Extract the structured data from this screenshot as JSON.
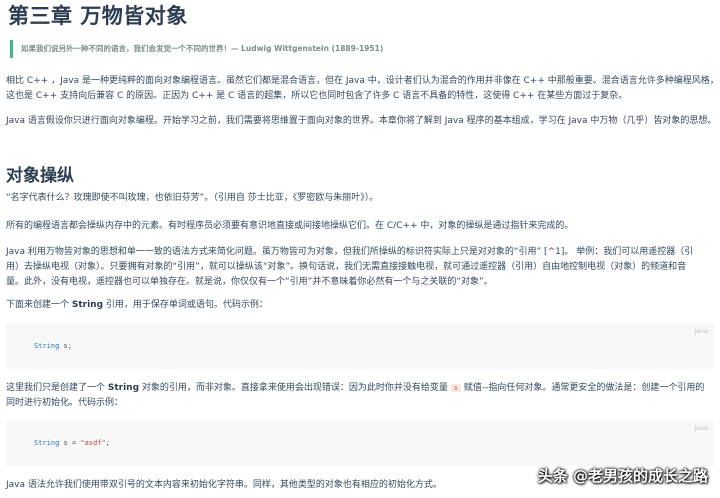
{
  "chapter_title": "第三章 万物皆对象",
  "quote": "如果我们说另外一种不同的语言，我们会发觉一个不同的世界！— Ludwig Wittgenstein (1889-1951)",
  "intro": {
    "line1": "相比 C++ ，Java 是一种更纯粹的面向对象编程语言。虽然它们都是混合语言，但在 Java 中，设计者们认为混合的作用并非像在 C++ 中那般重要。混合语言允许多种编程风格，",
    "line2": "这也是 C++ 支持向后兼容 C 的原因。正因为 C++ 是 C 语言的超集，所以它也同时包含了许多 C 语言不具备的特性，这使得 C++ 在某些方面过于复杂。"
  },
  "p2": "Java 语言假设你只进行面向对象编程。开始学习之前，我们需要将思维置于面向对象的世界。本章你将了解到 Java 程序的基本组成，学习在 Java 中万物（几乎）皆对象的思想。",
  "section_title": "对象操纵",
  "p3": "“名字代表什么？玫瑰即使不叫玫瑰，也依旧芬芳”。（引用自 莎士比亚，《罗密欧与朱丽叶》）。",
  "p4": "所有的编程语言都会操纵内存中的元素。有时程序员必须要有意识地直接或间接地操纵它们。在 C/C++ 中，对象的操纵是通过指针来完成的。",
  "p5": {
    "line1": "Java 利用万物皆对象的思想和单一一致的语法方式来简化问题。虽万物皆可为对象，但我们所操纵的标识符实际上只是对对象的“引用” [^1]。 举例：我们可以用遥控器（引",
    "line2": "用）去操纵电视（对象）。只要拥有对象的“引用”，就可以操纵该“对象”。换句话说，我们无需直接接触电视，就可通过遥控器（引用）自由地控制电视（对象）的频道和音",
    "line3": "量。此外，没有电视，遥控器也可以单独存在。就是说，你仅仅有一个“引用”并不意味着你必然有一个与之关联的“对象”。"
  },
  "p6": {
    "before": "下面来创建一个 ",
    "bold": "String",
    "after": " 引用，用于保存单词或语句。代码示例："
  },
  "code1": {
    "lang": "java",
    "type": "String",
    "rest": " s;"
  },
  "p7": {
    "a": "这里我们只是创建了一个 ",
    "bold": "String",
    "b": " 对象的引用，而非对象。直接拿来使用会出现错误：因为此时你并没有给变量 ",
    "code": "s",
    "c": " 赋值--指向任何对象。通常更安全的做法是：创建一个引用的",
    "line2": "同时进行初始化。代码示例："
  },
  "code2": {
    "lang": "java",
    "type": "String",
    "mid": " s = ",
    "str": "\"asdf\"",
    "end": ";"
  },
  "p8": "Java 语法允许我们使用带双引号的文本内容来初始化字符串。同样，其他类型的对象也有相应的初始化方式。",
  "watermark": "头条 @老男孩的成长之路"
}
